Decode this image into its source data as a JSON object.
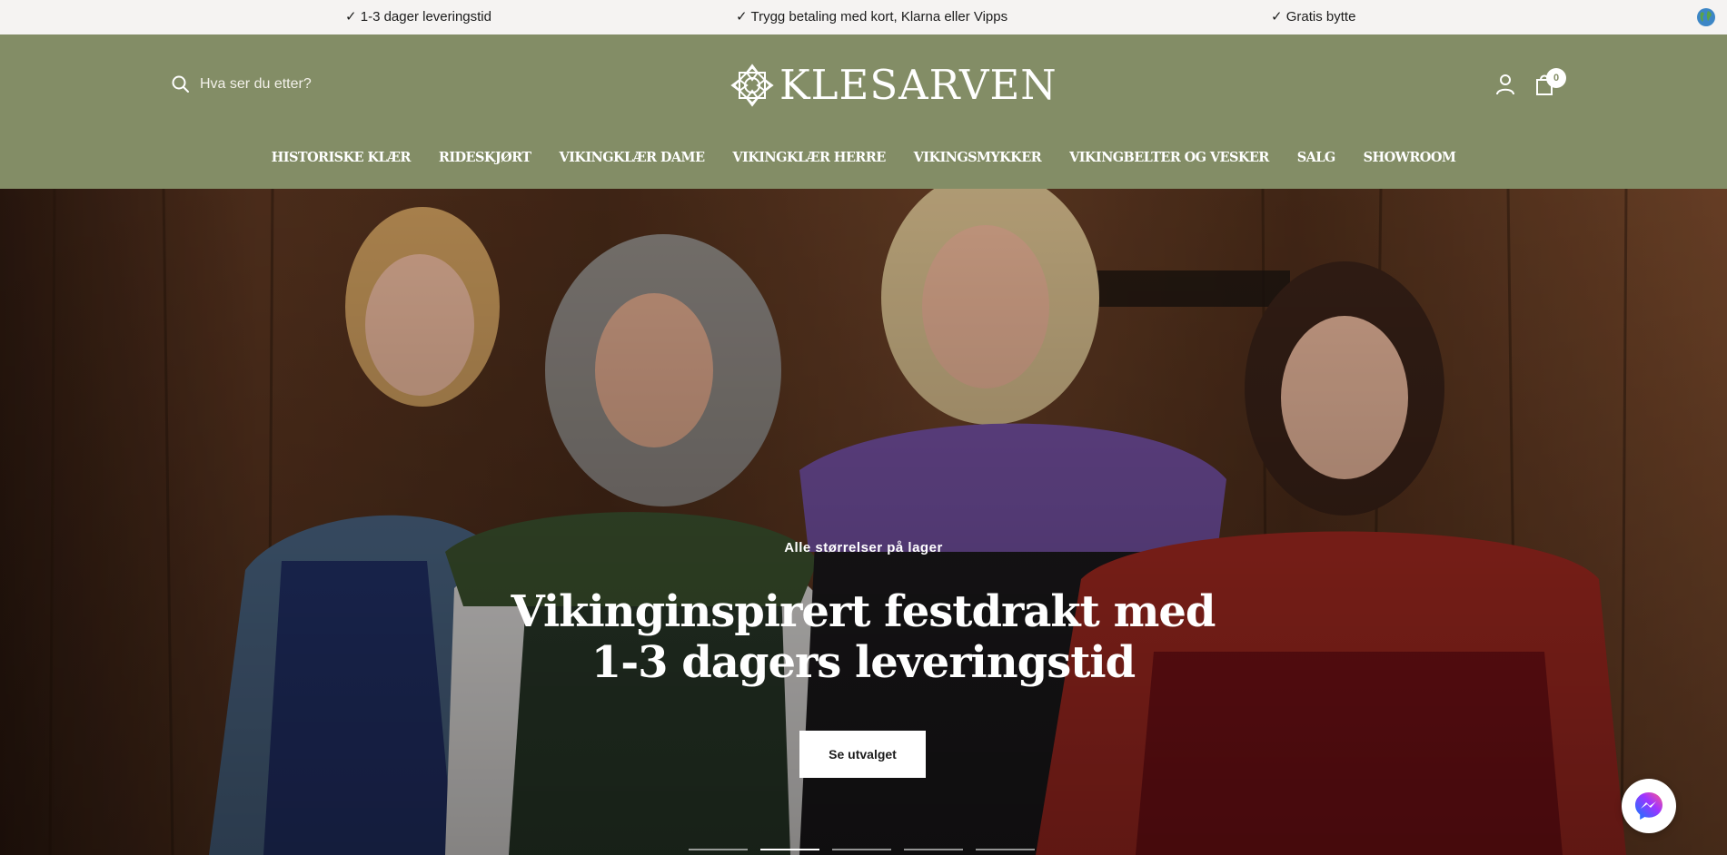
{
  "announcements": [
    "✓ 1-3 dager leveringstid",
    "✓ Trygg betaling med kort, Klarna eller Vipps",
    "✓ Gratis bytte"
  ],
  "header": {
    "search_placeholder": "Hva ser du etter?",
    "logo_text": "KLESARVEN",
    "cart_count": "0"
  },
  "nav": [
    "HISTORISKE KLÆR",
    "RIDESKJØRT",
    "VIKINGKLÆR DAME",
    "VIKINGKLÆR HERRE",
    "VIKINGSMYKKER",
    "VIKINGBELTER OG VESKER",
    "SALG",
    "SHOWROOM"
  ],
  "hero": {
    "subtitle": "Alle størrelser på lager",
    "title": "Vikinginspirert festdrakt med 1-3 dagers leveringstid",
    "button": "Se utvalget",
    "slide_count": 5,
    "active_slide": 2
  },
  "colors": {
    "header_bg": "#838d66",
    "topbar_bg": "#f5f3f2"
  }
}
